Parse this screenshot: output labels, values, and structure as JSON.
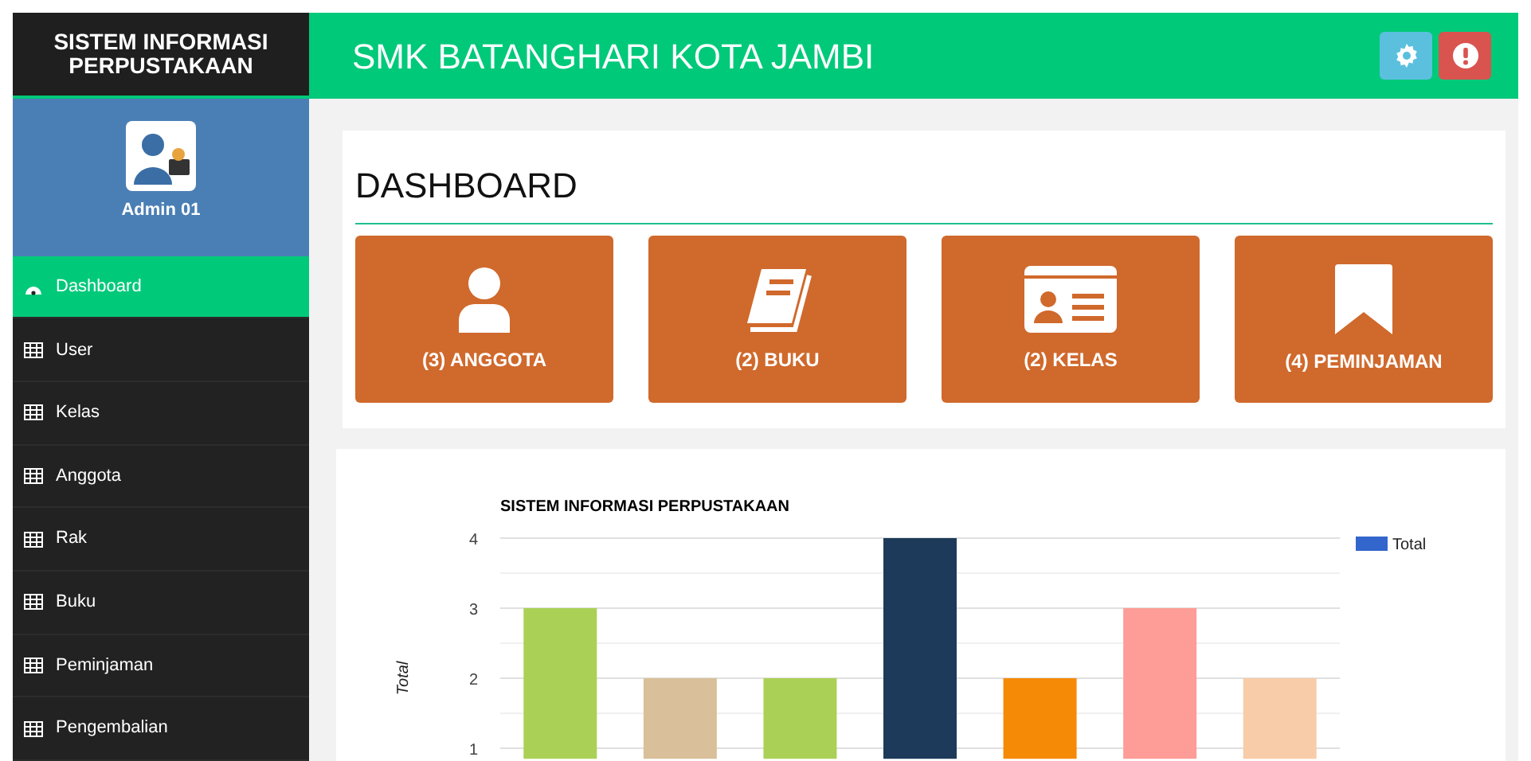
{
  "sidebar": {
    "brand": "SISTEM INFORMASI PERPUSTAKAAN",
    "user": {
      "name": "Admin 01"
    },
    "items": [
      {
        "label": "Dashboard",
        "kind": "dashboard",
        "selected": true
      },
      {
        "label": "User",
        "kind": "table",
        "selected": false
      },
      {
        "label": "Kelas",
        "kind": "table",
        "selected": false
      },
      {
        "label": "Anggota",
        "kind": "table",
        "selected": false
      },
      {
        "label": "Rak",
        "kind": "table",
        "selected": false
      },
      {
        "label": "Buku",
        "kind": "table",
        "selected": false
      },
      {
        "label": "Peminjaman",
        "kind": "table",
        "selected": false
      },
      {
        "label": "Pengembalian",
        "kind": "table",
        "selected": false
      }
    ]
  },
  "header": {
    "title": "SMK BATANGHARI KOTA JAMBI",
    "buttons": [
      {
        "kind": "settings"
      },
      {
        "kind": "alert"
      }
    ]
  },
  "dashboard": {
    "title": "DASHBOARD",
    "tiles": [
      {
        "label": "(3) ANGGOTA",
        "kind": "person"
      },
      {
        "label": "(2) BUKU",
        "kind": "book"
      },
      {
        "label": "(2) KELAS",
        "kind": "card"
      },
      {
        "label": "(4) PEMINJAMAN",
        "kind": "bookmark"
      }
    ]
  },
  "chart_panel": {
    "chart_data": {
      "type": "bar",
      "title": "SISTEM INFORMASI PERPUSTAKAAN",
      "ylabel": "Total",
      "ylim": [
        0.85,
        4
      ],
      "yticks": [
        1,
        2,
        3,
        4
      ],
      "grid": true,
      "series": [
        {
          "name": "Total",
          "color": "#3366cc",
          "values": [
            3,
            2,
            2,
            4,
            2,
            3,
            2
          ],
          "colors": [
            "#aad155",
            "#d9c09a",
            "#aad155",
            "#1d3a5a",
            "#f58a07",
            "#fe9c97",
            "#f8cca8"
          ]
        }
      ]
    }
  }
}
